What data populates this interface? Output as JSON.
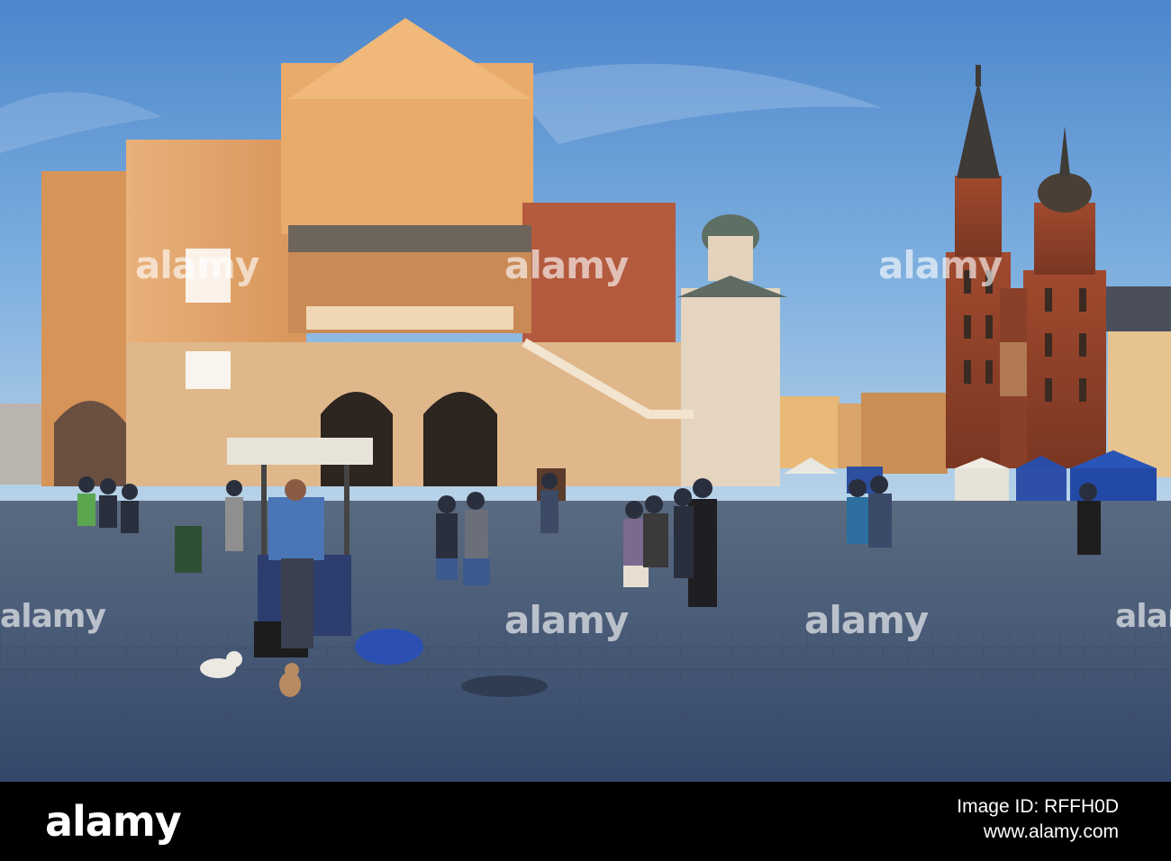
{
  "photo": {
    "scene": "Cloth Hall and St. Mary's Basilica, Main Market Square",
    "sky_color": "#5f95d2",
    "facade_color": "#e3a15f",
    "brick_color": "#8c3f29",
    "pavement_color": "#4a5d79"
  },
  "watermark": {
    "left": "alamy",
    "center": "alamy",
    "right": "alamy"
  },
  "footer": {
    "logo": "alamy",
    "image_id_label": "Image ID: RFFH0D",
    "site": "www.alamy.com"
  }
}
